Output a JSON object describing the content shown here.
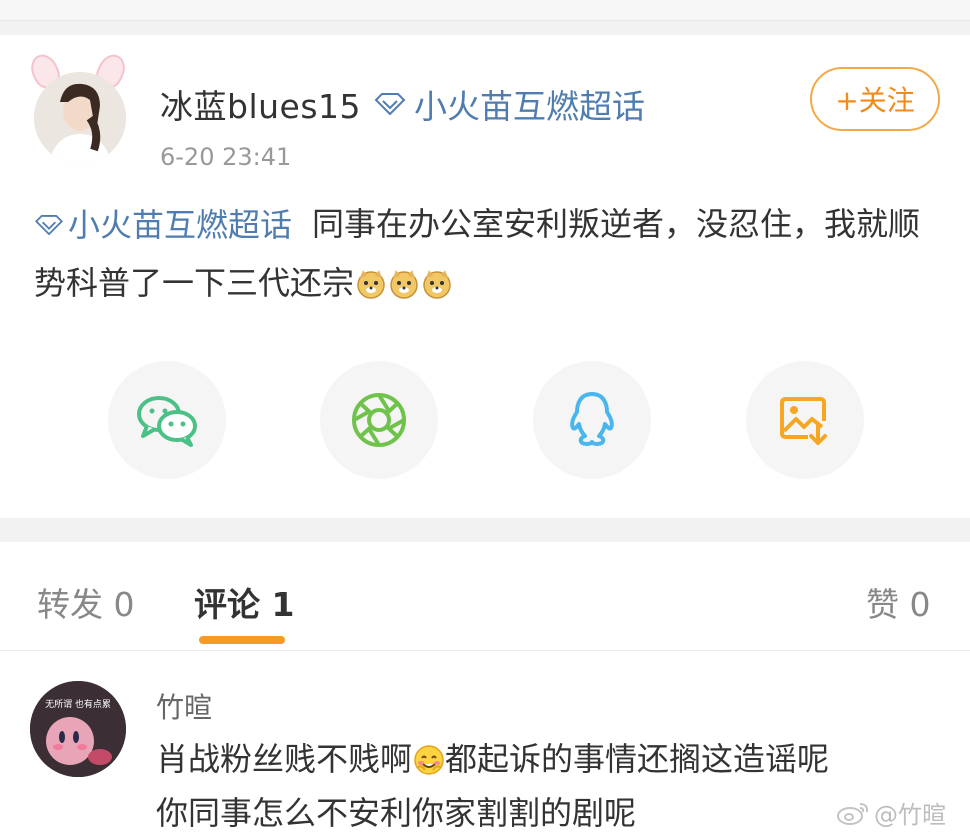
{
  "post": {
    "username": "冰蓝blues15",
    "supertopic_tag": "小火苗互燃超话",
    "time": "6-20 23:41",
    "follow_label": "+关注",
    "content_tag": "小火苗互燃超话",
    "content_text": "同事在办公室安利叛逆者，没忍住，我就顺势科普了一下三代还宗"
  },
  "share": {
    "icons": [
      "wechat-icon",
      "moments-icon",
      "qq-icon",
      "save-image-icon"
    ]
  },
  "tabs": {
    "repost_label": "转发",
    "repost_count": "0",
    "comment_label": "评论",
    "comment_count": "1",
    "like_label": "赞",
    "like_count": "0"
  },
  "comment": {
    "author": "竹暄",
    "avatar_caption": "无所谓 也有点累",
    "text_part1": "肖战粉丝贱不贱啊",
    "text_part2": "都起诉的事情还搁这造谣呢",
    "text_line2": "你同事怎么不安利你家割割的剧呢"
  },
  "watermark": "@竹暄",
  "colors": {
    "link_blue": "#507daf",
    "accent_orange": "#f59a23",
    "wechat_green": "#4cc187",
    "moments_green": "#6fc34b",
    "qq_blue": "#4ab6ed",
    "save_orange": "#f5a623"
  }
}
